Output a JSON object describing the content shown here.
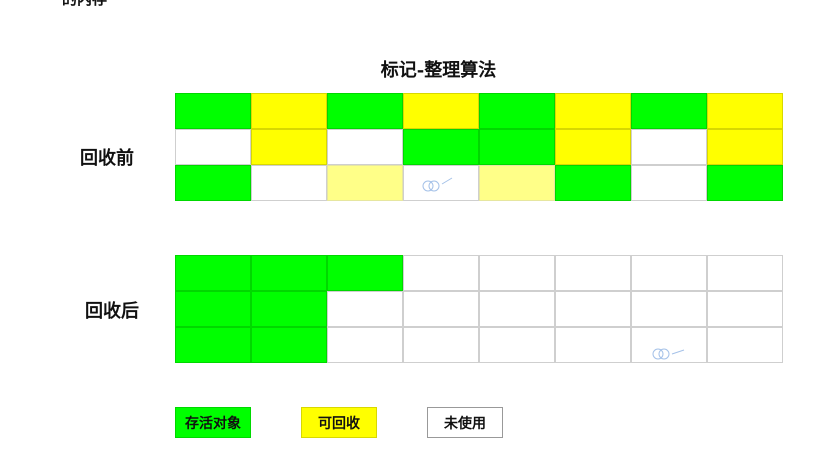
{
  "header": {
    "top_clip": "的内存"
  },
  "diagram": {
    "title": "标记-整理算法",
    "before_label": "回收前",
    "after_label": "回收后",
    "colors": {
      "live": "#00ff00",
      "garbage": "#ffff00",
      "garbage_light": "#ffff88",
      "free": "#ffffff"
    },
    "before_grid": [
      [
        "live",
        "garbage",
        "live",
        "garbage",
        "live",
        "garbage",
        "live",
        "garbage"
      ],
      [
        "free",
        "garbage",
        "free",
        "live",
        "live",
        "garbage",
        "free",
        "garbage"
      ],
      [
        "live",
        "free",
        "garbage-light",
        "free",
        "garbage-light",
        "live",
        "free",
        "live"
      ]
    ],
    "after_grid": [
      [
        "live",
        "live",
        "live",
        "free",
        "free",
        "free",
        "free",
        "free"
      ],
      [
        "live",
        "live",
        "free",
        "free",
        "free",
        "free",
        "free",
        "free"
      ],
      [
        "live",
        "live",
        "free",
        "free",
        "free",
        "free",
        "free",
        "free"
      ]
    ]
  },
  "legend": {
    "live": "存活对象",
    "garbage": "可回收",
    "free": "未使用"
  }
}
